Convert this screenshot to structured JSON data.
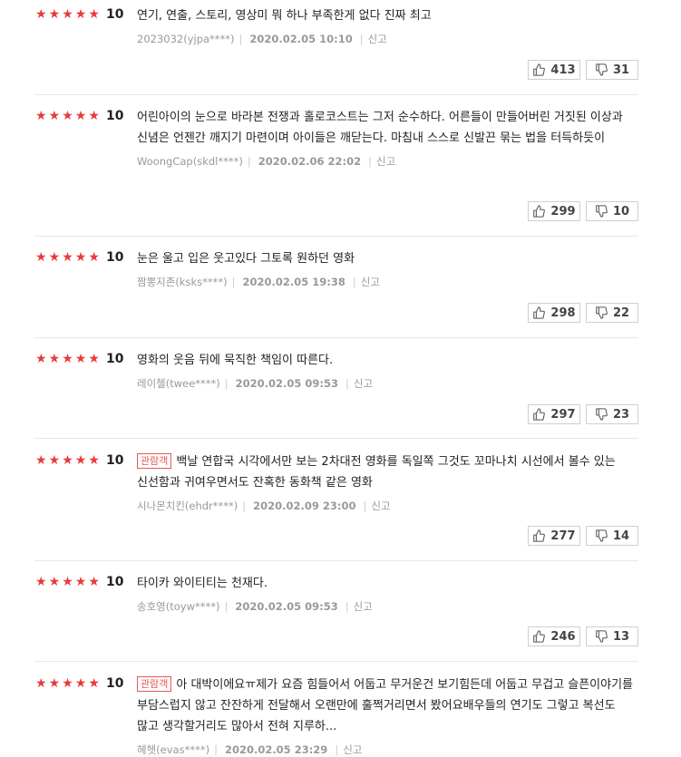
{
  "reviews": [
    {
      "stars": "★★★★★",
      "score": "10",
      "badge": "",
      "text": "연기, 연출, 스토리, 영상미 뭐 하나 부족한게 없다 진짜 최고",
      "author": "2023032(yjpa****)",
      "date": "2020.02.05 10:10",
      "report": "신고",
      "likes": "413",
      "dislikes": "31"
    },
    {
      "stars": "★★★★★",
      "score": "10",
      "badge": "",
      "text": "어린아이의 눈으로 바라본 전쟁과 홀로코스트는 그저 순수하다. 어른들이 만들어버린 거짓된 이상과 신념은 언젠간 깨지기 마련이며 아이들은 깨닫는다. 마침내 스스로 신발끈 묶는 법을 터득하듯이",
      "author": "WoongCap(skdl****)",
      "date": "2020.02.06 22:02",
      "report": "신고",
      "likes": "299",
      "dislikes": "10"
    },
    {
      "stars": "★★★★★",
      "score": "10",
      "badge": "",
      "text": "눈은 울고 입은 웃고있다 그토록 원하던 영화",
      "author": "짬뽕지존(ksks****)",
      "date": "2020.02.05 19:38",
      "report": "신고",
      "likes": "298",
      "dislikes": "22"
    },
    {
      "stars": "★★★★★",
      "score": "10",
      "badge": "",
      "text": "영화의 웃음 뒤에 묵직한 책임이 따른다.",
      "author": "레이첼(twee****)",
      "date": "2020.02.05 09:53",
      "report": "신고",
      "likes": "297",
      "dislikes": "23"
    },
    {
      "stars": "★★★★★",
      "score": "10",
      "badge": "관람객",
      "text": "백날 연합국 시각에서만 보는 2차대전 영화를 독일쪽 그것도 꼬마나치 시선에서 볼수 있는 신선함과 귀여우면서도 잔혹한 동화책 같은 영화",
      "author": "시나몬치킨(ehdr****)",
      "date": "2020.02.09 23:00",
      "report": "신고",
      "likes": "277",
      "dislikes": "14"
    },
    {
      "stars": "★★★★★",
      "score": "10",
      "badge": "",
      "text": "타이카 와이티티는 천재다.",
      "author": "송호영(toyw****)",
      "date": "2020.02.05 09:53",
      "report": "신고",
      "likes": "246",
      "dislikes": "13"
    },
    {
      "stars": "★★★★★",
      "score": "10",
      "badge": "관람객",
      "text": "아 대박이에요ㅠ제가 요즘 힘들어서 어둡고 무거운건 보기힘든데 어둡고 무겁고 슬픈이야기를 부담스럽지 않고 잔잔하게 전달해서 오랜만에 훌쩍거리면서 봤어요배우들의 연기도 그렇고 복선도 많고 생각할거리도 많아서 전혀 지루하...",
      "author": "혜헷(evas****)",
      "date": "2020.02.05 23:29",
      "report": "신고",
      "likes": "",
      "dislikes": ""
    }
  ]
}
